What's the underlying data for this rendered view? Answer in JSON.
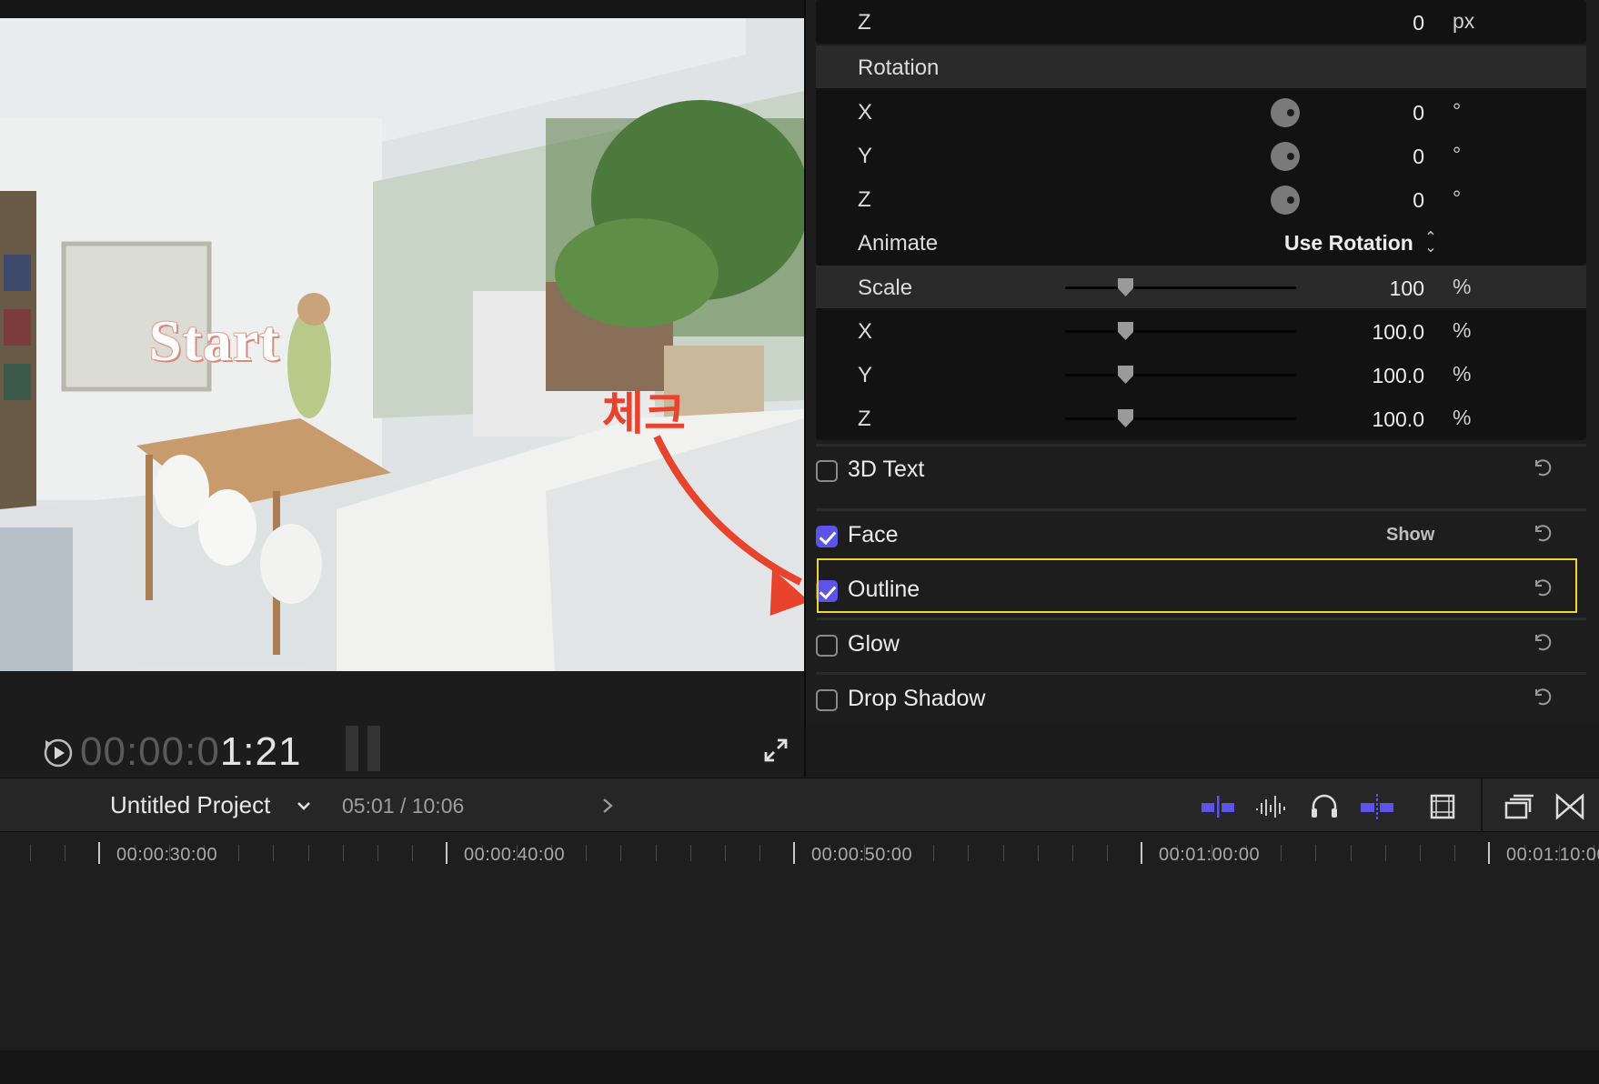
{
  "viewer": {
    "title_overlay": "Start",
    "annotation": "체크",
    "timecode_dim": "00:00:0",
    "timecode_lit": "1:21"
  },
  "inspector": {
    "position_z": {
      "label": "Z",
      "value": "0",
      "unit": "px"
    },
    "rotation": {
      "header": "Rotation",
      "rows": [
        {
          "label": "X",
          "value": "0",
          "unit": "°"
        },
        {
          "label": "Y",
          "value": "0",
          "unit": "°"
        },
        {
          "label": "Z",
          "value": "0",
          "unit": "°"
        }
      ],
      "animate_label": "Animate",
      "animate_value": "Use Rotation"
    },
    "scale": {
      "header": "Scale",
      "value": "100",
      "unit": "%",
      "rows": [
        {
          "label": "X",
          "value": "100.0",
          "unit": "%"
        },
        {
          "label": "Y",
          "value": "100.0",
          "unit": "%"
        },
        {
          "label": "Z",
          "value": "100.0",
          "unit": "%"
        }
      ]
    },
    "sections": [
      {
        "label": "3D Text",
        "checked": false
      },
      {
        "label": "Face",
        "checked": true,
        "extra": "Show"
      },
      {
        "label": "Outline",
        "checked": true
      },
      {
        "label": "Glow",
        "checked": false
      },
      {
        "label": "Drop Shadow",
        "checked": false
      }
    ]
  },
  "project": {
    "name": "Untitled Project",
    "duration": "05:01 / 10:06"
  },
  "timeline": {
    "ruler_labels": [
      "00:00:30:00",
      "00:00:40:00",
      "00:00:50:00",
      "00:01:00:00",
      "00:01:10:00"
    ]
  },
  "colors": {
    "accent": "#5b54e6",
    "highlight": "#f0d43c",
    "annotation": "#e8432d"
  }
}
